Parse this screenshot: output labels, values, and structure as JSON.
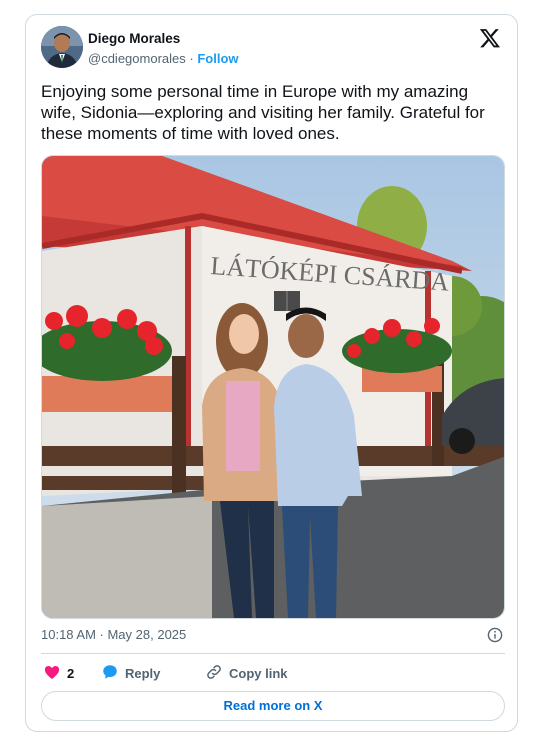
{
  "author": {
    "display_name": "Diego Morales",
    "handle": "@cdiegomorales",
    "separator": "·",
    "follow_label": "Follow"
  },
  "tweet": {
    "text": "Enjoying some personal time in Europe with my amazing wife, Sidonia—exploring and visiting her family. Grateful for these moments of time with loved ones.",
    "photo_sign_text": "LÁTÓKÉPI CSÁRDA",
    "timestamp": "10:18 AM · May 28, 2025"
  },
  "actions": {
    "like_count": "2",
    "reply_label": "Reply",
    "copy_link_label": "Copy link"
  },
  "footer": {
    "read_more_label": "Read more on X"
  },
  "icons": [
    "x-logo-icon",
    "info-icon",
    "heart-icon",
    "reply-bubble-icon",
    "link-icon"
  ],
  "colors": {
    "accent": "#1d9bf0",
    "link": "#006fd6",
    "like": "#f91880",
    "text": "#0f1419",
    "secondary": "#536471",
    "border": "#cfd9de"
  }
}
